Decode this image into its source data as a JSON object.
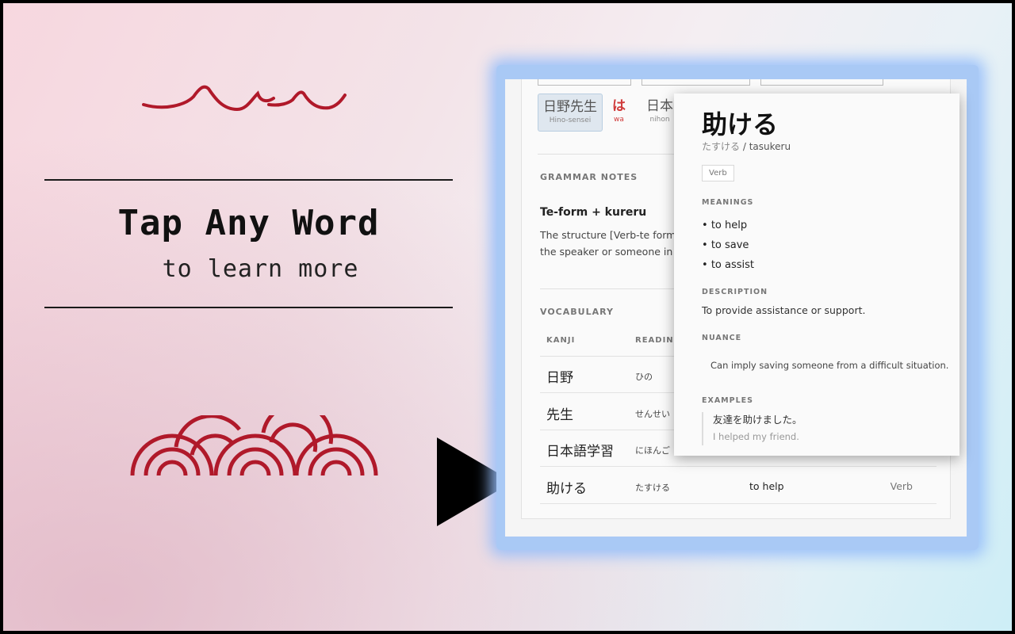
{
  "promo": {
    "headline": "Tap Any Word",
    "subline": "to learn more"
  },
  "colors": {
    "accent_red": "#b0192a",
    "glow_blue": "#a9c9f5"
  },
  "sentence_chips": [
    {
      "jp": "日野先生",
      "romaji": "Hino-sensei",
      "selected": true
    },
    {
      "jp": "は",
      "romaji": "wa",
      "particle": true
    },
    {
      "jp": "日本",
      "romaji": "nihon"
    }
  ],
  "grammar": {
    "section_label": "GRAMMAR NOTES",
    "title": "Te-form + kureru",
    "body_line1": "The structure [Verb-te form",
    "body_line2": "the speaker or someone in"
  },
  "vocabulary": {
    "section_label": "VOCABULARY",
    "col_kanji": "KANJI",
    "col_reading": "READING",
    "rows": [
      {
        "kanji": "日野",
        "reading": "ひの",
        "meaning": "",
        "pos": ""
      },
      {
        "kanji": "先生",
        "reading": "せんせい",
        "meaning": "",
        "pos": ""
      },
      {
        "kanji": "日本語学習",
        "reading": "にほんご",
        "meaning": "",
        "pos": ""
      },
      {
        "kanji": "助ける",
        "reading": "たすける",
        "meaning": "to help",
        "pos": "Verb"
      }
    ]
  },
  "popup": {
    "word": "助ける",
    "kana": "たすける",
    "sep": "/",
    "romaji": "tasukeru",
    "pos": "Verb",
    "meanings_label": "MEANINGS",
    "meanings": [
      "to help",
      "to save",
      "to assist"
    ],
    "description_label": "DESCRIPTION",
    "description": "To provide assistance or support.",
    "nuance_label": "NUANCE",
    "nuance": "Can imply saving someone from a difficult situation.",
    "examples_label": "EXAMPLES",
    "example_ja": "友達を助けました。",
    "example_en": "I helped my friend."
  }
}
